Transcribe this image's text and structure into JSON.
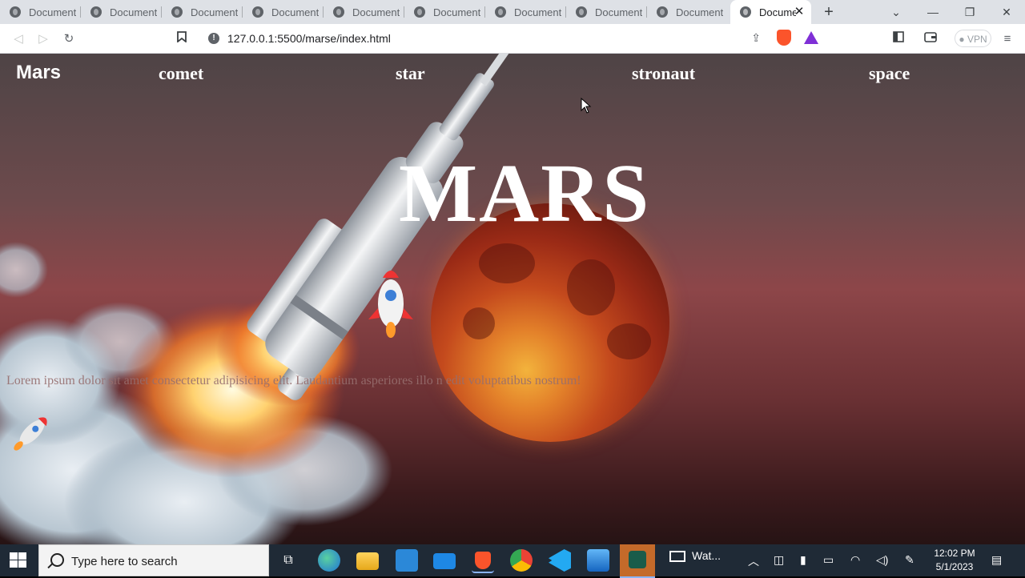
{
  "browser": {
    "tabs": [
      {
        "label": "Document"
      },
      {
        "label": "Document"
      },
      {
        "label": "Document"
      },
      {
        "label": "Document"
      },
      {
        "label": "Document"
      },
      {
        "label": "Document"
      },
      {
        "label": "Document"
      },
      {
        "label": "Document"
      },
      {
        "label": "Document"
      },
      {
        "label": "Document"
      }
    ],
    "new_tab": "+",
    "close_tab": "✕",
    "url": "127.0.0.1:5500/marse/index.html",
    "vpn_label": "VPN",
    "window_controls": {
      "minimize": "—",
      "restore": "❐",
      "close": "✕",
      "tab_search": "⌄"
    }
  },
  "site": {
    "logo": "Mars",
    "nav": [
      "comet",
      "star",
      "stronaut",
      "space"
    ],
    "hero_title": "MARS",
    "lorem": "Lorem ipsum dolor sit amet consectetur adipisicing elit. Laudantium asperiores illo n                                                                            edit voluptatibus nostrum!"
  },
  "taskbar": {
    "search_placeholder": "Type here to search",
    "watch_label": "Wat...",
    "time": "12:02 PM",
    "date": "5/1/2023"
  },
  "colors": {
    "tabbar": "#dee1e6",
    "page_top": "#4e4446",
    "page_mid": "#8d4649",
    "planet": "#c44a1d",
    "taskbar": "#1f2a36"
  }
}
